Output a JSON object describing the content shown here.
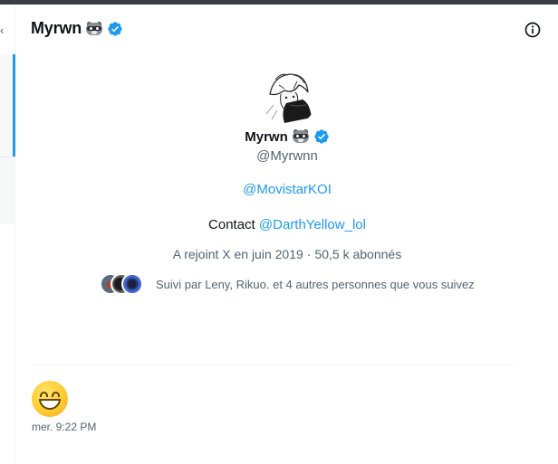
{
  "header": {
    "display_name": "Myrwn",
    "name_emoji": "raccoon",
    "verified_icon": "verified-badge-icon",
    "info_icon": "info-icon"
  },
  "profile": {
    "display_name": "Myrwn",
    "handle": "@Myrwnn",
    "bio_line1_link": "@MovistarKOI",
    "bio_line2_prefix": "Contact",
    "bio_line2_link": "@DarthYellow_lol",
    "joined": "A rejoint X en juin 2019",
    "separator": "·",
    "followers": "50,5 k abonnés",
    "followed_by": "Suivi par Leny, Rikuo. et 4 autres personnes que vous suivez"
  },
  "message": {
    "emoji": "grinning-face",
    "timestamp": "mer. 9:22 PM"
  },
  "colors": {
    "accent": "#1d9bf0",
    "secondary_text": "#536471",
    "primary_text": "#0f1419"
  }
}
